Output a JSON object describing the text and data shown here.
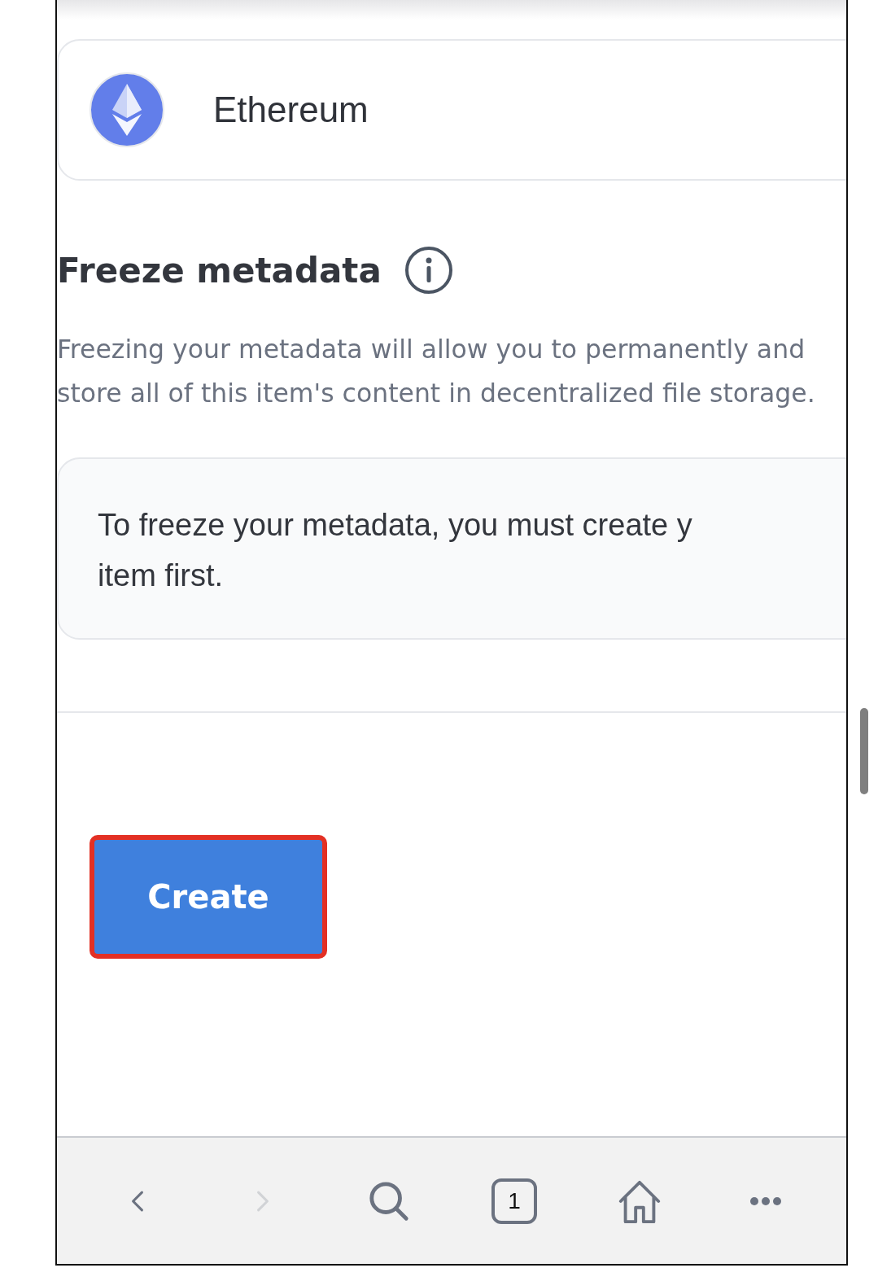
{
  "blockchain": {
    "name": "Ethereum"
  },
  "freeze": {
    "title": "Freeze metadata",
    "description": "Freezing your metadata will allow you to permanently and store all of this item's content in decentralized file storage.",
    "notice_lines": [
      "To freeze your metadata, you must create y",
      "item first."
    ]
  },
  "create_button": {
    "label": "Create",
    "highlighted": true
  },
  "browser_bar": [
    {
      "kind": "back",
      "disabled": false
    },
    {
      "kind": "forward",
      "disabled": true
    },
    {
      "kind": "search",
      "disabled": false
    },
    {
      "kind": "tabs",
      "count": "1",
      "disabled": false
    },
    {
      "kind": "home",
      "disabled": false
    },
    {
      "kind": "more",
      "disabled": false
    }
  ]
}
